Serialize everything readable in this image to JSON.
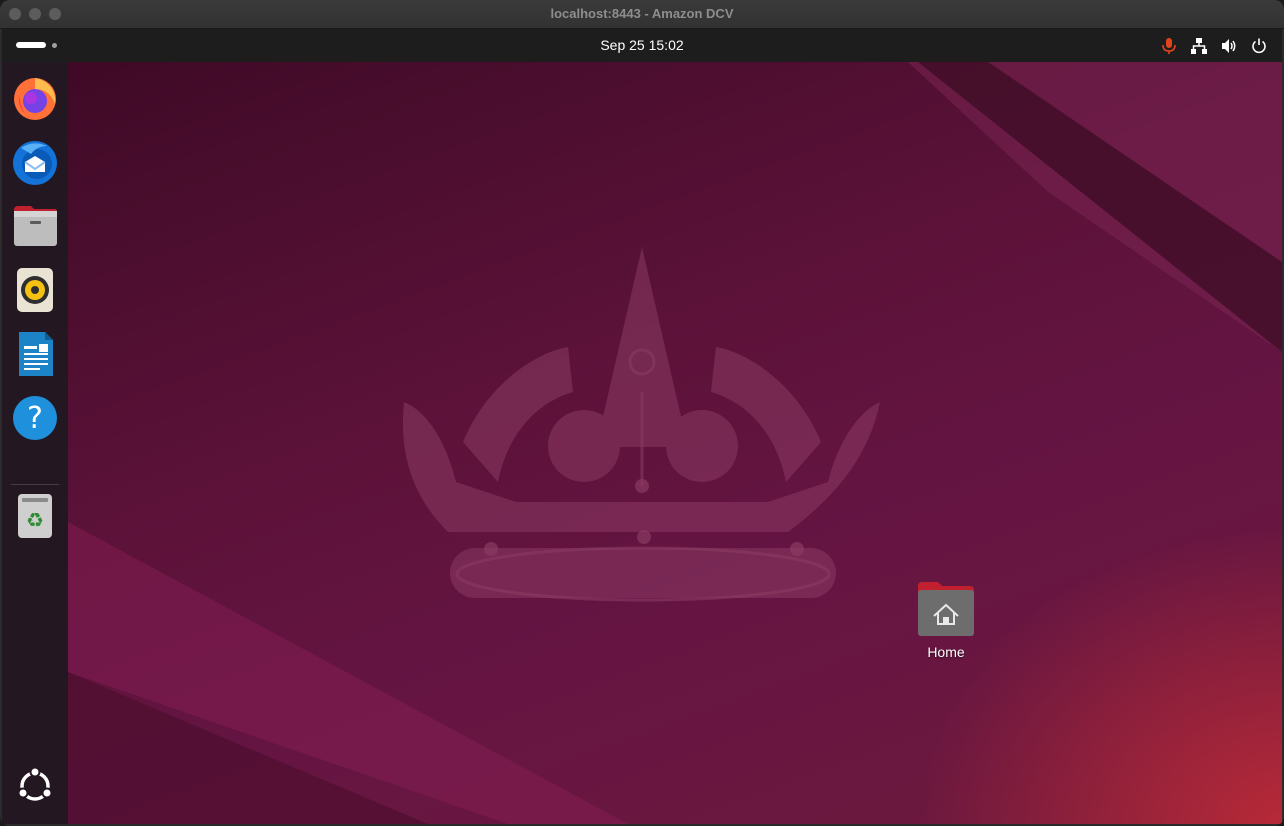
{
  "window": {
    "title": "localhost:8443 - Amazon DCV"
  },
  "topbar": {
    "clock": "Sep 25  15:02"
  },
  "tray": [
    "microphone-icon",
    "network-icon",
    "volume-icon",
    "power-icon"
  ],
  "dock": {
    "items": [
      {
        "name": "Firefox",
        "icon": "firefox-icon"
      },
      {
        "name": "Thunderbird",
        "icon": "thunderbird-icon"
      },
      {
        "name": "Files",
        "icon": "files-icon"
      },
      {
        "name": "Rhythmbox",
        "icon": "rhythmbox-icon"
      },
      {
        "name": "LibreOffice Writer",
        "icon": "writer-icon"
      },
      {
        "name": "Help",
        "icon": "help-icon"
      },
      {
        "name": "Trash",
        "icon": "trash-icon"
      },
      {
        "name": "Show Apps",
        "icon": "ubuntu-apps-icon"
      }
    ]
  },
  "desktop": {
    "home_label": "Home"
  },
  "colors": {
    "accent": "#e95420",
    "mic_active": "#e0441b"
  }
}
